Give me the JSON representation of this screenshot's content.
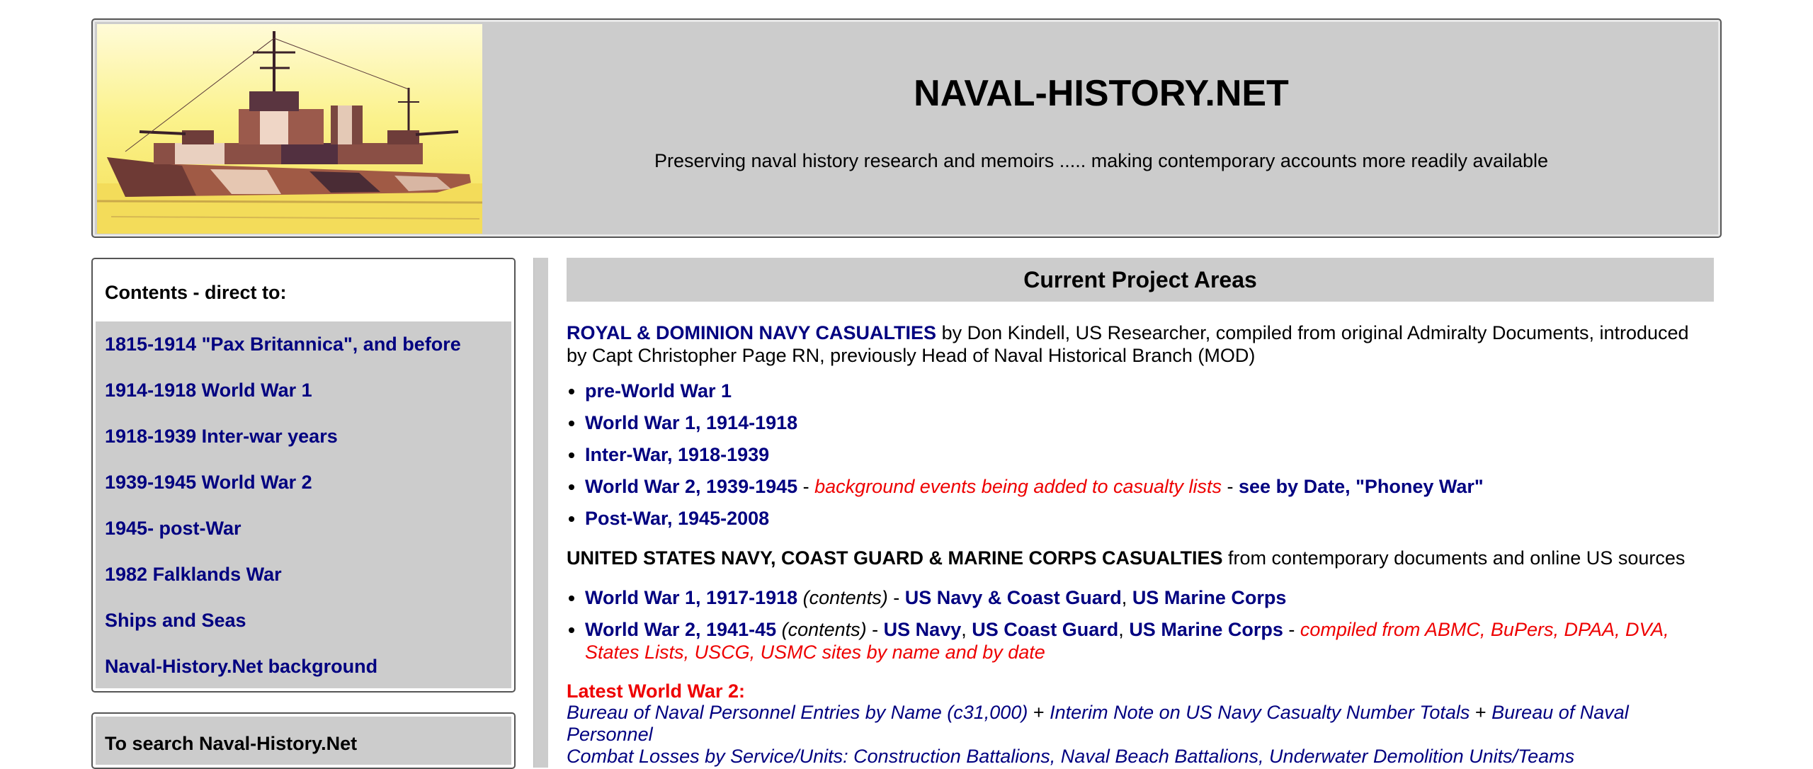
{
  "header": {
    "site_title": "NAVAL-HISTORY.NET",
    "tagline": "Preserving naval history research and memoirs ..... making contemporary accounts more readily available"
  },
  "sidebar": {
    "heading": "Contents - direct to:",
    "items": [
      {
        "label": "1815-1914 \"Pax Britannica\", and before"
      },
      {
        "label": "1914-1918 World War 1"
      },
      {
        "label": "1918-1939 Inter-war years"
      },
      {
        "label": "1939-1945 World War 2"
      },
      {
        "label": "1945- post-War"
      },
      {
        "label": "1982 Falklands War"
      },
      {
        "label": "Ships and Seas"
      },
      {
        "label": "Naval-History.Net background"
      }
    ],
    "search_heading": "To search Naval-History.Net"
  },
  "main": {
    "title": "Current Project Areas",
    "rn": {
      "link": "ROYAL & DOMINION NAVY CASUALTIES",
      "text": " by Don Kindell, US Researcher, compiled from original Admiralty Documents, introduced by Capt Christopher Page RN, previously Head of Naval Historical Branch (MOD)",
      "items": {
        "pre_ww1": "pre-World War 1",
        "ww1": "World War 1, 1914-1918",
        "interwar": "Inter-War, 1918-1939",
        "ww2": "World War 2, 1939-1945",
        "ww2_sep1": " - ",
        "ww2_note": "background events being added to casualty lists",
        "ww2_sep2": " - ",
        "ww2_link": "see by Date, \"Phoney War\"",
        "postwar": "Post-War, 1945-2008"
      }
    },
    "us": {
      "title": "UNITED STATES NAVY, COAST GUARD & MARINE CORPS CASUALTIES",
      "text": " from contemporary documents and online US sources",
      "ww1": {
        "link": "World War 1, 1917-1918",
        "contents": " (contents)",
        "sep": " - ",
        "navy_cg": "US Navy & Coast Guard",
        "comma": ", ",
        "marines": "US Marine Corps"
      },
      "ww2": {
        "link": "World War 2, 1941-45",
        "contents": " (contents)",
        "sep": " - ",
        "navy": "US Navy",
        "comma1": ", ",
        "cg": "US Coast Guard",
        "comma2": ", ",
        "marines": "US Marine Corps",
        "sep2": " - ",
        "note": "compiled from ABMC, BuPers, DPAA, DVA, States Lists, USCG, USMC sites by name and by date"
      }
    },
    "latest": {
      "title": "Latest World War 2:",
      "line1": {
        "part1": "Bureau of Naval Personnel Entries by Name (c31,000)",
        "plus1": " + ",
        "part2": "Interim Note on US Navy Casualty Number Totals",
        "plus2": " + ",
        "part3": "Bureau of Naval Personnel"
      },
      "line2": "Combat Losses by Service/Units: Construction Battalions, Naval Beach Battalions, Underwater Demolition Units/Teams"
    }
  }
}
